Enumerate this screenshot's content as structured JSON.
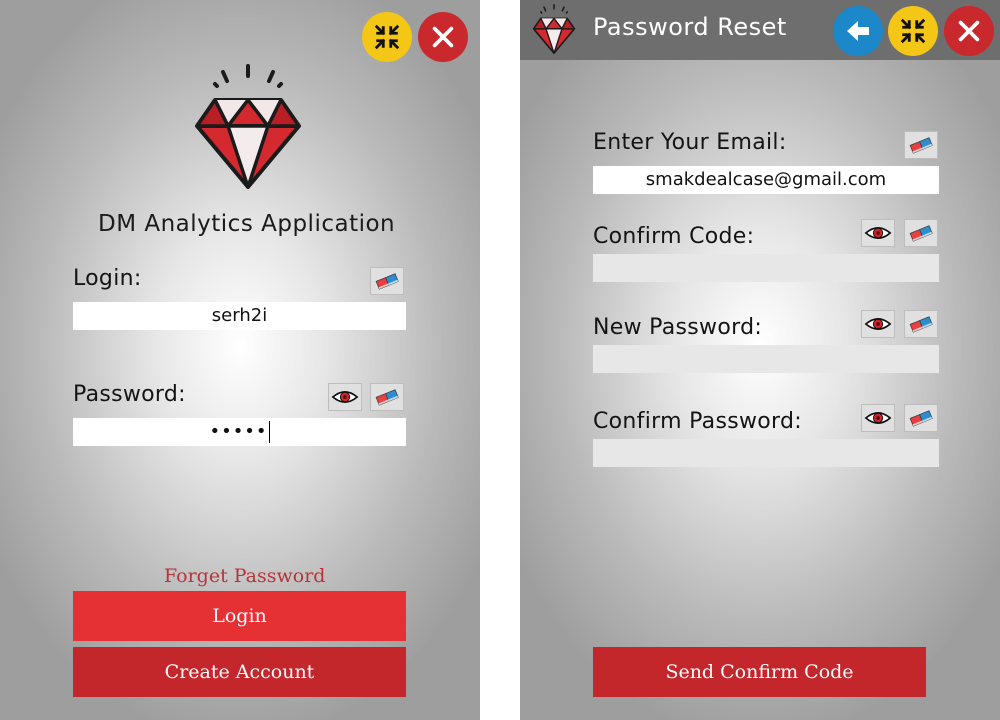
{
  "login_window": {
    "app_title": "DM Analytics Application",
    "login_label": "Login:",
    "login_value": "serh2i",
    "password_label": "Password:",
    "password_value": "•••••",
    "forget_password_link": "Forget Password",
    "login_button": "Login",
    "create_account_button": "Create Account",
    "icons": [
      "minimize-icon",
      "close-icon",
      "diamond-logo-icon",
      "eraser-icon",
      "eye-icon"
    ]
  },
  "reset_window": {
    "title": "Password Reset",
    "email_label": "Enter Your Email:",
    "email_value": "smakdealcase@gmail.com",
    "confirm_code_label": "Confirm Code:",
    "confirm_code_value": "",
    "new_password_label": "New Password:",
    "new_password_value": "",
    "confirm_password_label": "Confirm Password:",
    "confirm_password_value": "",
    "send_button": "Send Confirm Code",
    "icons": [
      "back-arrow-icon",
      "minimize-icon",
      "close-icon",
      "diamond-logo-icon",
      "eraser-icon",
      "eye-icon"
    ]
  },
  "colors": {
    "primary_red": "#e53034",
    "dark_red": "#c3262b",
    "yellow": "#f4c616",
    "blue": "#1c87c9",
    "title_bar": "#6e6e6e",
    "link": "#b8333a"
  }
}
